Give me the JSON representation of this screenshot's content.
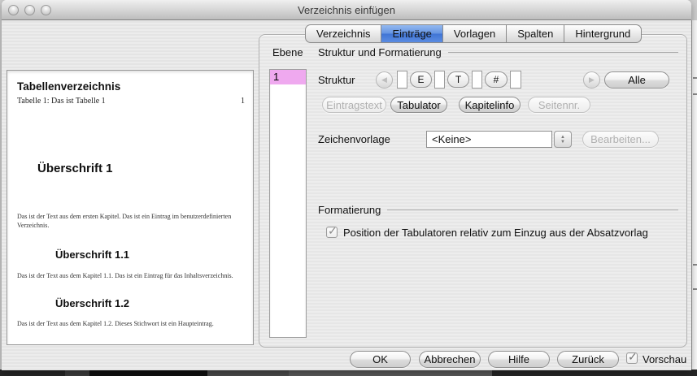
{
  "window": {
    "title": "Verzeichnis einfügen"
  },
  "tabs": [
    {
      "label": "Verzeichnis",
      "selected": false
    },
    {
      "label": "Einträge",
      "selected": true
    },
    {
      "label": "Vorlagen",
      "selected": false
    },
    {
      "label": "Spalten",
      "selected": false
    },
    {
      "label": "Hintergrund",
      "selected": false
    }
  ],
  "levels": {
    "label": "Ebene",
    "selected_level": "1"
  },
  "structure": {
    "section_title": "Struktur und Formatierung",
    "row_label": "Struktur",
    "tokens": {
      "entry": "E",
      "tab": "T",
      "page": "#"
    },
    "all_button": "Alle",
    "token_buttons": {
      "eintragstext": "Eintragstext",
      "tabulator": "Tabulator",
      "kapitelinfo": "Kapitelinfo",
      "seitennr": "Seitennr."
    },
    "char_style_label": "Zeichenvorlage",
    "char_style_value": "<Keine>",
    "edit_button": "Bearbeiten..."
  },
  "formatting": {
    "section_title": "Formatierung",
    "tab_position_label": "Position der Tabulatoren relativ zum Einzug aus der Absatzvorlag",
    "tab_position_checked": true
  },
  "preview": {
    "index_title": "Tabellenverzeichnis",
    "index_entry": "Tabelle 1: Das ist Tabelle 1",
    "index_entry_page": "1",
    "heading1": "Überschrift 1",
    "para1": "Das ist der Text aus dem ersten Kapitel. Das ist ein Eintrag im benutzerdefinierten Verzeichnis.",
    "heading11": "Überschrift 1.1",
    "para2": "Das ist der Text aus dem Kapitel 1.1. Das ist ein Eintrag für das Inhaltsverzeichnis.",
    "heading12": "Überschrift 1.2",
    "para3": "Das ist der Text aus dem Kapitel 1.2. Dieses Stichwort ist ein Haupteintrag."
  },
  "footer": {
    "ok": "OK",
    "cancel": "Abbrechen",
    "help": "Hilfe",
    "back": "Zurück",
    "preview_label": "Vorschau",
    "preview_checked": true
  },
  "colors": {
    "selected_tab_blue": "#4a7fd6",
    "level_selection_pink": "#efa9ef"
  }
}
